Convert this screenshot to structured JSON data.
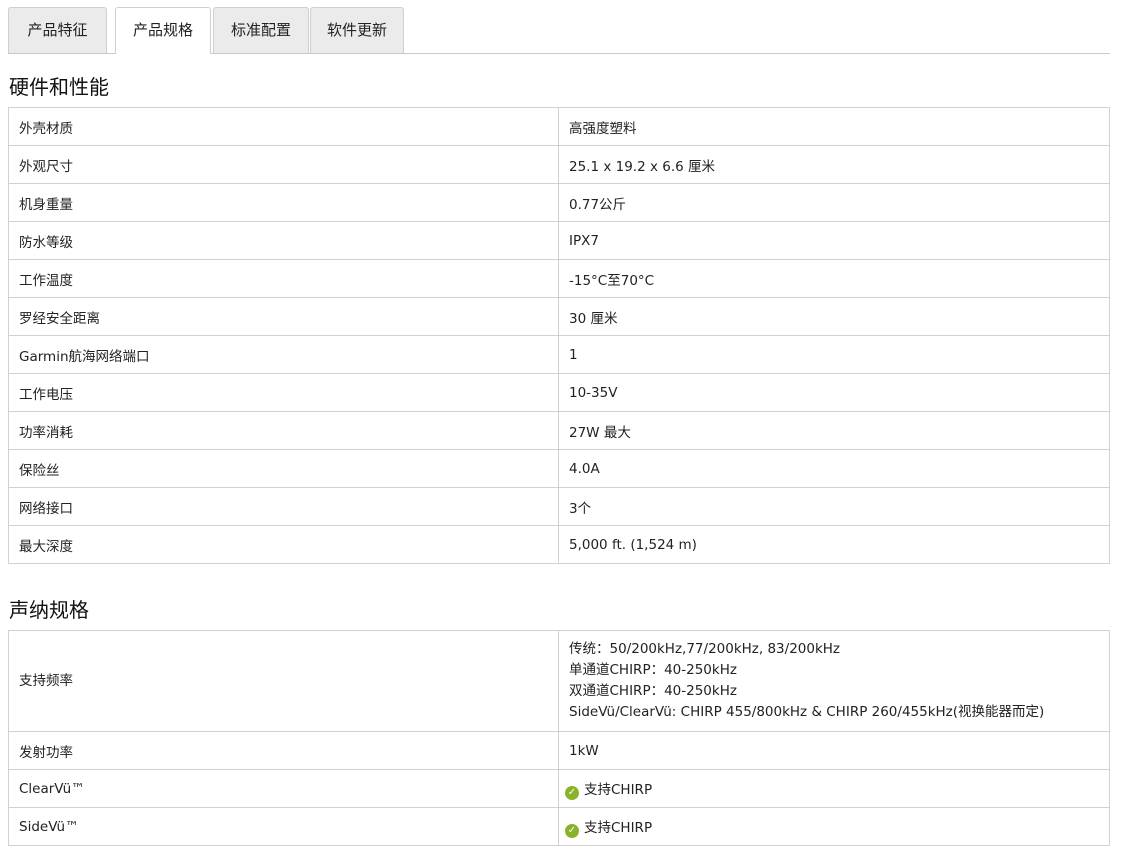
{
  "tabs": [
    {
      "label": "产品特征",
      "active": false
    },
    {
      "label": "产品规格",
      "active": true
    },
    {
      "label": "标准配置",
      "active": false
    },
    {
      "label": "软件更新",
      "active": false
    }
  ],
  "hardware": {
    "title": "硬件和性能",
    "rows": [
      {
        "key": "外壳材质",
        "value": "高强度塑料"
      },
      {
        "key": "外观尺寸",
        "value": "25.1 x 19.2 x 6.6 厘米"
      },
      {
        "key": "机身重量",
        "value": "0.77公斤"
      },
      {
        "key": "防水等级",
        "value": "IPX7"
      },
      {
        "key": "工作温度",
        "value": "-15°C至70°C"
      },
      {
        "key": "罗经安全距离",
        "value": "30 厘米"
      },
      {
        "key": "Garmin航海网络端口",
        "value": "1"
      },
      {
        "key": "工作电压",
        "value": "10-35V"
      },
      {
        "key": "功率消耗",
        "value": "27W 最大"
      },
      {
        "key": "保险丝",
        "value": "4.0A"
      },
      {
        "key": "网络接口",
        "value": "3个"
      },
      {
        "key": "最大深度",
        "value": "5,000 ft. (1,524 m)"
      }
    ]
  },
  "sonar": {
    "title": "声纳规格",
    "frequency": {
      "key": "支持频率",
      "lines": [
        "传统：50/200kHz,77/200kHz, 83/200kHz",
        "单通道CHIRP：40-250kHz",
        "双通道CHIRP：40-250kHz",
        "SideVü/ClearVü: CHIRP 455/800kHz & CHIRP 260/455kHz(视换能器而定)"
      ]
    },
    "power": {
      "key": "发射功率",
      "value": "1kW"
    },
    "clearvu": {
      "key": "ClearVü™",
      "value": "支持CHIRP",
      "icon": "check-circle-icon"
    },
    "sidevu": {
      "key": "SideVü™",
      "value": "支持CHIRP",
      "icon": "check-circle-icon"
    },
    "check_color": "#8ab32b"
  }
}
